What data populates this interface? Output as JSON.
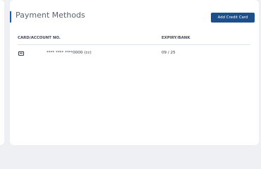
{
  "header": {
    "title": "Payment Methods",
    "add_button_label": "Add Credit Card"
  },
  "table": {
    "columns": [
      "CARD/ACCOUNT NO.",
      "EXPIRY/BANK"
    ],
    "rows": [
      {
        "icon": "credit-card-icon",
        "card": "**** **** ****0000 (cc)",
        "expiry": "09 / 25"
      }
    ]
  },
  "colors": {
    "accent": "#1a5ea8",
    "button": "#1c4f8c"
  }
}
